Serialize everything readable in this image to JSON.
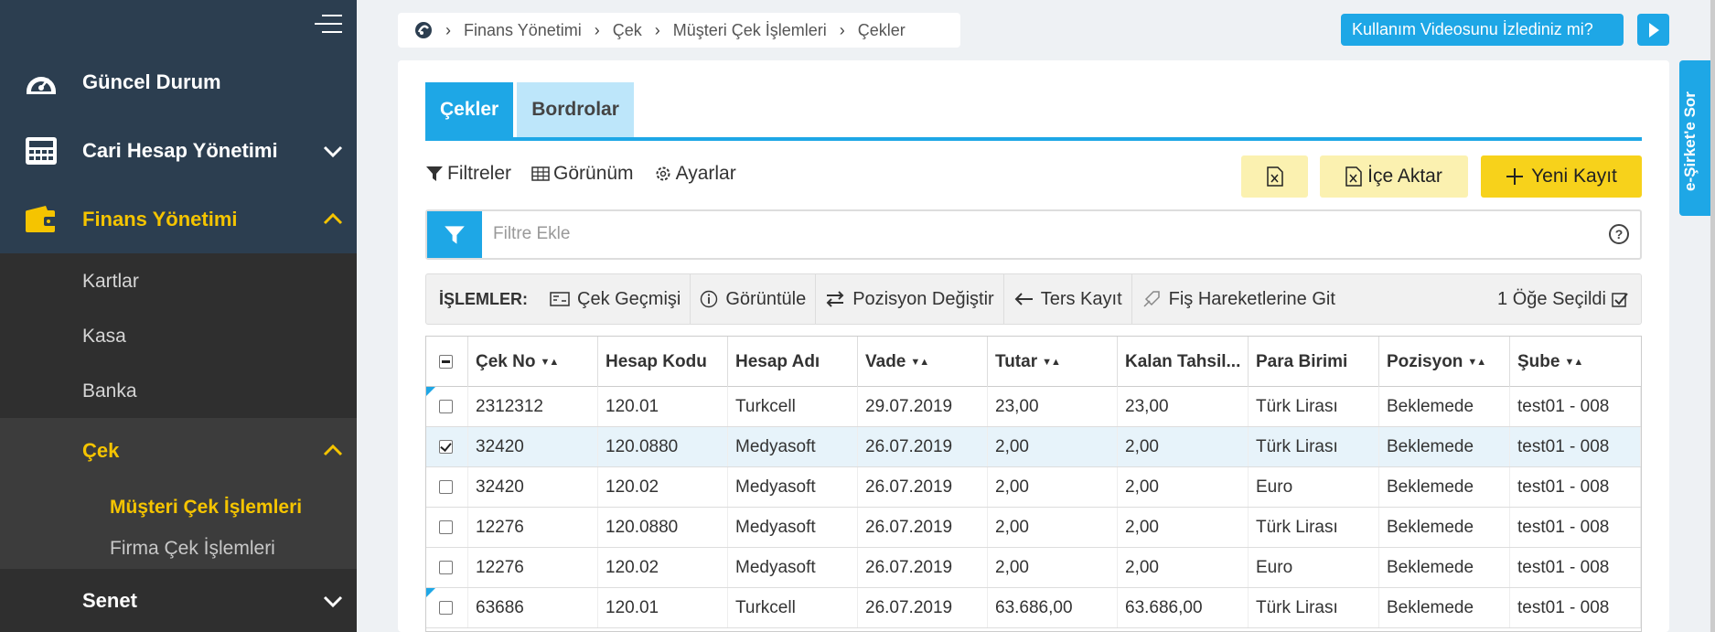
{
  "sidebar": {
    "items": [
      {
        "label": "Güncel Durum"
      },
      {
        "label": "Cari Hesap Yönetimi"
      },
      {
        "label": "Finans Yönetimi"
      }
    ],
    "finance_subitems": [
      "Kartlar",
      "Kasa",
      "Banka"
    ],
    "cek_label": "Çek",
    "cek_subitems": [
      "Müşteri Çek İşlemleri",
      "Firma Çek İşlemleri"
    ],
    "senet_label": "Senet"
  },
  "breadcrumb": [
    "Finans Yönetimi",
    "Çek",
    "Müşteri Çek İşlemleri",
    "Çekler"
  ],
  "video_banner": "Kullanım Videosunu İzlediniz mi?",
  "side_tab": "e-Şirket'e Sor",
  "tabs": [
    "Çekler",
    "Bordrolar"
  ],
  "toolbar": {
    "filters": "Filtreler",
    "view": "Görünüm",
    "settings": "Ayarlar",
    "import": "İçe Aktar",
    "new_record": "Yeni Kayıt"
  },
  "filter": {
    "placeholder": "Filtre Ekle",
    "help": "?"
  },
  "operations": {
    "label": "İŞLEMLER:",
    "history": "Çek Geçmişi",
    "view": "Görüntüle",
    "change_position": "Pozisyon Değiştir",
    "reverse": "Ters Kayıt",
    "go_to_slip": "Fiş Hareketlerine Git",
    "selected_count": "1 Öğe Seçildi"
  },
  "table": {
    "columns": [
      "Çek No",
      "Hesap Kodu",
      "Hesap Adı",
      "Vade",
      "Tutar",
      "Kalan Tahsil...",
      "Para Birimi",
      "Pozisyon",
      "Şube"
    ],
    "rows": [
      {
        "cek_no": "2312312",
        "hesap_kodu": "120.01",
        "hesap_adi": "Turkcell",
        "vade": "29.07.2019",
        "tutar": "23,00",
        "kalan": "23,00",
        "para_birimi": "Türk Lirası",
        "pozisyon": "Beklemede",
        "sube": "test01 - 008"
      },
      {
        "cek_no": "32420",
        "hesap_kodu": "120.0880",
        "hesap_adi": "Medyasoft",
        "vade": "26.07.2019",
        "tutar": "2,00",
        "kalan": "2,00",
        "para_birimi": "Türk Lirası",
        "pozisyon": "Beklemede",
        "sube": "test01 - 008"
      },
      {
        "cek_no": "32420",
        "hesap_kodu": "120.02",
        "hesap_adi": "Medyasoft",
        "vade": "26.07.2019",
        "tutar": "2,00",
        "kalan": "2,00",
        "para_birimi": "Euro",
        "pozisyon": "Beklemede",
        "sube": "test01 - 008"
      },
      {
        "cek_no": "12276",
        "hesap_kodu": "120.0880",
        "hesap_adi": "Medyasoft",
        "vade": "26.07.2019",
        "tutar": "2,00",
        "kalan": "2,00",
        "para_birimi": "Türk Lirası",
        "pozisyon": "Beklemede",
        "sube": "test01 - 008"
      },
      {
        "cek_no": "12276",
        "hesap_kodu": "120.02",
        "hesap_adi": "Medyasoft",
        "vade": "26.07.2019",
        "tutar": "2,00",
        "kalan": "2,00",
        "para_birimi": "Euro",
        "pozisyon": "Beklemede",
        "sube": "test01 - 008"
      },
      {
        "cek_no": "63686",
        "hesap_kodu": "120.01",
        "hesap_adi": "Turkcell",
        "vade": "26.07.2019",
        "tutar": "63.686,00",
        "kalan": "63.686,00",
        "para_birimi": "Türk Lirası",
        "pozisyon": "Beklemede",
        "sube": "test01 - 008"
      }
    ]
  },
  "colors": {
    "accent": "#1ea7e6",
    "brand_yellow": "#f5c400",
    "sidebar_dark": "#2c3e50"
  }
}
